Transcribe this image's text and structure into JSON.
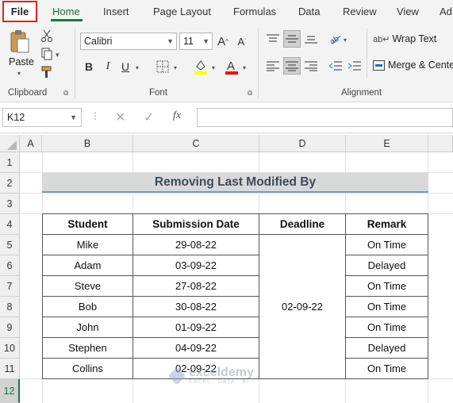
{
  "tabs": [
    "File",
    "Home",
    "Insert",
    "Page Layout",
    "Formulas",
    "Data",
    "Review",
    "View",
    "Ad"
  ],
  "ribbon": {
    "clipboard": {
      "paste_label": "Paste",
      "group_label": "Clipboard"
    },
    "font": {
      "font_name": "Calibri",
      "font_size": "11",
      "group_label": "Font",
      "fill_color": "#ffff00",
      "font_color": "#ff0000"
    },
    "alignment": {
      "wrap_text": "Wrap Text",
      "merge_center": "Merge & Center",
      "group_label": "Alignment"
    }
  },
  "formula_bar": {
    "name_box": "K12",
    "fx": "fx",
    "formula": ""
  },
  "columns": [
    "A",
    "B",
    "C",
    "D",
    "E"
  ],
  "rows": [
    "1",
    "2",
    "3",
    "4",
    "5",
    "6",
    "7",
    "8",
    "9",
    "10",
    "11",
    "12"
  ],
  "sheet": {
    "title": "Removing Last Modified By",
    "headers": [
      "Student",
      "Submission Date",
      "Deadline",
      "Remark"
    ],
    "deadline": "02-09-22",
    "records": [
      {
        "student": "Mike",
        "date": "29-08-22",
        "remark": "On Time"
      },
      {
        "student": "Adam",
        "date": "03-09-22",
        "remark": "Delayed"
      },
      {
        "student": "Steve",
        "date": "27-08-22",
        "remark": "On Time"
      },
      {
        "student": "Bob",
        "date": "30-08-22",
        "remark": "On Time"
      },
      {
        "student": "John",
        "date": "01-09-22",
        "remark": "On Time"
      },
      {
        "student": "Stephen",
        "date": "04-09-22",
        "remark": "Delayed"
      },
      {
        "student": "Collins",
        "date": "02-09-22",
        "remark": "On Time"
      }
    ]
  },
  "watermark": {
    "brand": "exceldemy",
    "tagline": "EXCEL · DATA · BI"
  },
  "colors": {
    "title_fill": "#d9d9d9",
    "title_underline": "#6d9ccf",
    "excel_green": "#217346",
    "file_border": "#e0202a"
  }
}
